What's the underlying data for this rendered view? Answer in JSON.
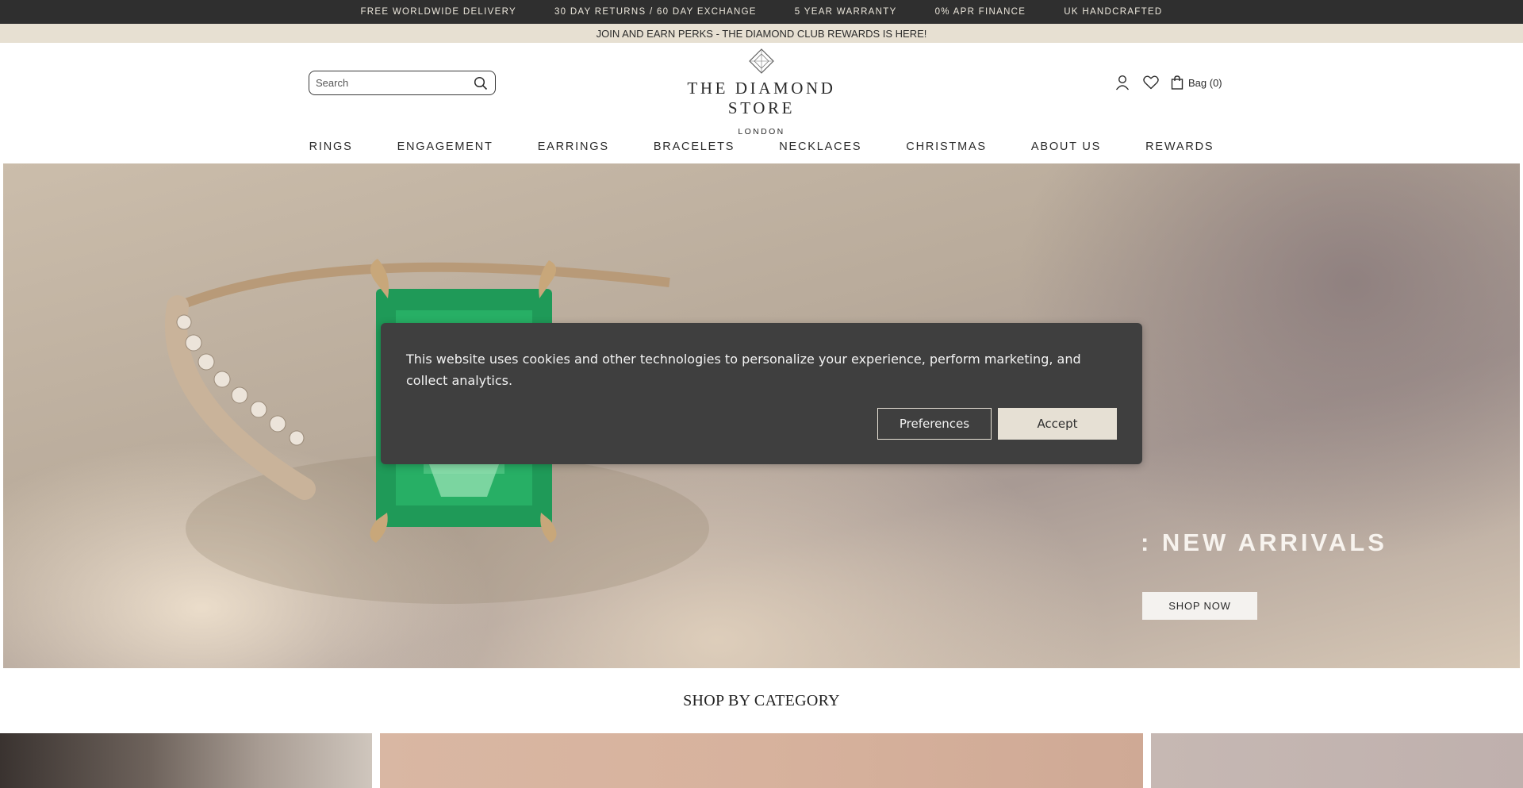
{
  "topbar": {
    "items": [
      "FREE WORLDWIDE DELIVERY",
      "30 DAY RETURNS / 60 DAY EXCHANGE",
      "5 YEAR WARRANTY",
      "0% APR FINANCE",
      "UK HANDCRAFTED"
    ]
  },
  "promo": {
    "text": "JOIN AND EARN PERKS - THE DIAMOND CLUB REWARDS IS HERE!"
  },
  "header": {
    "search_placeholder": "Search",
    "logo_name": "THE DIAMOND STORE",
    "logo_city": "LONDON",
    "bag_label": "Bag (0)",
    "icons": [
      "search-icon",
      "account-icon",
      "heart-icon",
      "bag-icon",
      "diamond-logo-icon"
    ]
  },
  "nav": {
    "items": [
      "RINGS",
      "ENGAGEMENT",
      "EARRINGS",
      "BRACELETS",
      "NECKLACES",
      "CHRISTMAS",
      "ABOUT US",
      "REWARDS"
    ]
  },
  "hero": {
    "heading": ": NEW ARRIVALS",
    "button_label": "SHOP NOW"
  },
  "cookie_banner": {
    "text": "This website uses cookies and other technologies to personalize your experience, perform marketing, and collect analytics.",
    "preferences_label": "Preferences",
    "accept_label": "Accept"
  },
  "category_section": {
    "title": "SHOP BY CATEGORY"
  },
  "colors": {
    "topbar_bg": "#2f2f2f",
    "promo_bg": "#e7e0d2",
    "banner_bg": "#3f3f3f",
    "accept_bg": "#e6e0d4",
    "emerald": "#1f9a58"
  }
}
